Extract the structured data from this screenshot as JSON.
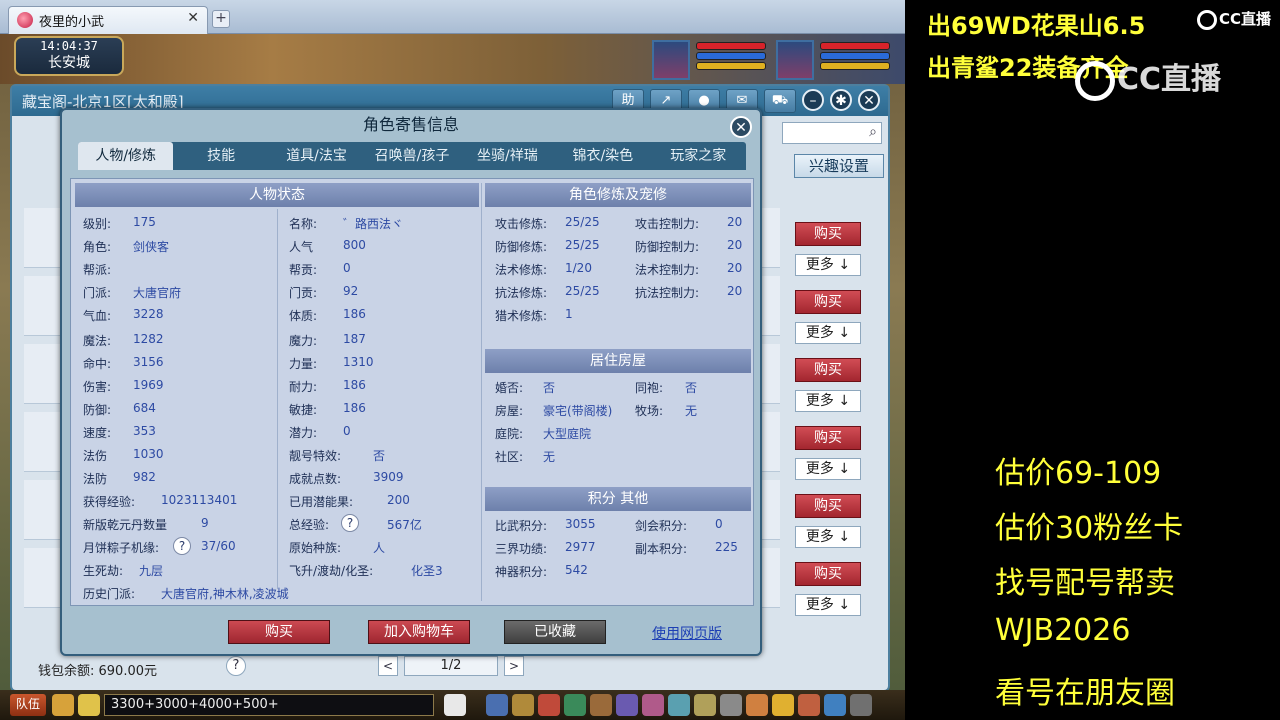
{
  "browser": {
    "tab_title": "夜里的小武",
    "tab_close": "✕",
    "new_tab": "+"
  },
  "game_hud": {
    "time": "14:04:37",
    "city": "长安城"
  },
  "cbg_window": {
    "title": "藏宝阁-北京1区[太和殿]",
    "tool_help": "助",
    "interest_settings": "兴趣设置",
    "buy_label": "购买",
    "more_label": "更多 ↓",
    "wallet": "钱包余额: 690.00元",
    "help_q": "?",
    "page": "1/2",
    "prev": "<",
    "next": ">"
  },
  "dialog": {
    "title": "角色寄售信息",
    "close": "✕",
    "tabs": [
      "人物/修炼",
      "技能",
      "道具/法宝",
      "召唤兽/孩子",
      "坐骑/祥瑞",
      "锦衣/染色",
      "玩家之家"
    ],
    "section_status": "人物状态",
    "section_cultivation": "角色修炼及宠修",
    "section_house": "居住房屋",
    "section_points": "积分 其他",
    "status_left": [
      {
        "k": "级别:",
        "v": "175"
      },
      {
        "k": "角色:",
        "v": "剑侠客"
      },
      {
        "k": "帮派:",
        "v": ""
      },
      {
        "k": "门派:",
        "v": "大唐官府"
      },
      {
        "k": "气血:",
        "v": "3228"
      },
      {
        "k": "魔法:",
        "v": "1282"
      },
      {
        "k": "命中:",
        "v": "3156"
      },
      {
        "k": "伤害:",
        "v": "1969"
      },
      {
        "k": "防御:",
        "v": "684"
      },
      {
        "k": "速度:",
        "v": "353"
      },
      {
        "k": "法伤",
        "v": "1030"
      },
      {
        "k": "法防",
        "v": "982"
      },
      {
        "k": "获得经验:",
        "v": "1023113401"
      },
      {
        "k": "新版乾元丹数量",
        "v": "9"
      },
      {
        "k": "月饼粽子机缘:",
        "v": "37/60"
      },
      {
        "k": "生死劫:",
        "v": "九层"
      }
    ],
    "status_right": [
      {
        "k": "名称:",
        "v": "゛路西法ヾ"
      },
      {
        "k": "人气",
        "v": "800"
      },
      {
        "k": "帮贡:",
        "v": "0"
      },
      {
        "k": "门贡:",
        "v": "92"
      },
      {
        "k": "体质:",
        "v": "186"
      },
      {
        "k": "魔力:",
        "v": "187"
      },
      {
        "k": "力量:",
        "v": "1310"
      },
      {
        "k": "耐力:",
        "v": "186"
      },
      {
        "k": "敏捷:",
        "v": "186"
      },
      {
        "k": "潜力:",
        "v": "0"
      },
      {
        "k": "靓号特效:",
        "v": "否"
      },
      {
        "k": "成就点数:",
        "v": "3909"
      },
      {
        "k": "已用潜能果:",
        "v": "200"
      },
      {
        "k": "总经验:",
        "v": "567亿"
      },
      {
        "k": "原始种族:",
        "v": "人"
      },
      {
        "k": "飞升/渡劫/化圣:",
        "v": "化圣3"
      }
    ],
    "history_label": "历史门派:",
    "history_value": "大唐官府,神木林,凌波城",
    "cultivation": [
      {
        "k": "攻击修炼:",
        "v": "25/25",
        "k2": "攻击控制力:",
        "v2": "20"
      },
      {
        "k": "防御修炼:",
        "v": "25/25",
        "k2": "防御控制力:",
        "v2": "20"
      },
      {
        "k": "法术修炼:",
        "v": "1/20",
        "k2": "法术控制力:",
        "v2": "20"
      },
      {
        "k": "抗法修炼:",
        "v": "25/25",
        "k2": "抗法控制力:",
        "v2": "20"
      },
      {
        "k": "猎术修炼:",
        "v": "1",
        "k2": "",
        "v2": ""
      }
    ],
    "house": [
      {
        "k": "婚否:",
        "v": "否",
        "k2": "同袍:",
        "v2": "否"
      },
      {
        "k": "房屋:",
        "v": "豪宅(带阁楼)",
        "k2": "牧场:",
        "v2": "无"
      },
      {
        "k": "庭院:",
        "v": "大型庭院",
        "k2": "",
        "v2": ""
      },
      {
        "k": "社区:",
        "v": "无",
        "k2": "",
        "v2": ""
      }
    ],
    "points": [
      {
        "k": "比武积分:",
        "v": "3055",
        "k2": "剑会积分:",
        "v2": "0"
      },
      {
        "k": "三界功绩:",
        "v": "2977",
        "k2": "副本积分:",
        "v2": "225"
      },
      {
        "k": "神器积分:",
        "v": "542",
        "k2": "",
        "v2": ""
      }
    ],
    "btn_buy": "购买",
    "btn_cart": "加入购物车",
    "btn_fav": "已收藏",
    "link_web": "使用网页版"
  },
  "bottom": {
    "team": "队伍",
    "chat_text": "3300+3000+4000+500+"
  },
  "overlay": {
    "line1": "出69WD花果山6.5",
    "line2": "出青鲨22装备齐全",
    "logo": "CC直播",
    "lines": [
      "估价69-109",
      "估价30粉丝卡",
      "找号配号帮卖",
      " WJB2026",
      "看号在朋友圈"
    ]
  }
}
